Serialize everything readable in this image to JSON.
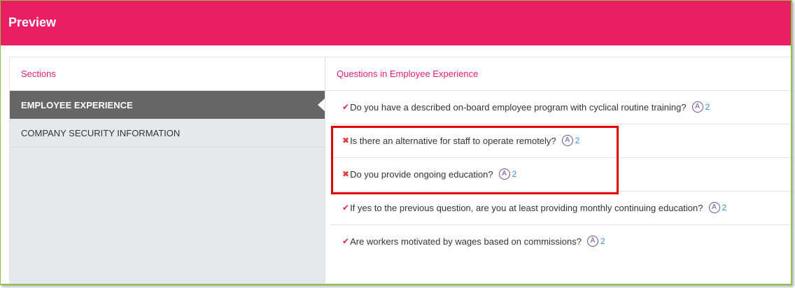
{
  "header": {
    "title": "Preview",
    "color": "#e91e63"
  },
  "sidebar": {
    "heading": "Sections",
    "items": [
      {
        "label": "EMPLOYEE EXPERIENCE",
        "active": true
      },
      {
        "label": "COMPANY SECURITY INFORMATION",
        "active": false
      }
    ]
  },
  "main": {
    "heading": "Questions in Employee Experience",
    "questions": [
      {
        "status": "check",
        "text": "Do you have a described on-board employee program with cyclical routine training?",
        "answer_icon": "A",
        "count": "2"
      },
      {
        "status": "cross",
        "text": "Is there an alternative for staff to operate remotely?",
        "answer_icon": "A",
        "count": "2"
      },
      {
        "status": "cross",
        "text": "Do you provide ongoing education?",
        "answer_icon": "A",
        "count": "2"
      },
      {
        "status": "check",
        "text": "If yes to the previous question, are you at least providing monthly continuing education?",
        "answer_icon": "A",
        "count": "2"
      },
      {
        "status": "check",
        "text": "Are workers motivated by wages based on commissions?",
        "answer_icon": "A",
        "count": "2"
      }
    ]
  },
  "icons": {
    "check": "✔",
    "cross": "✖"
  },
  "colors": {
    "accent": "#e91e63",
    "highlight": "#e00000",
    "frame": "#8cc34a",
    "link": "#3b8fd9"
  }
}
